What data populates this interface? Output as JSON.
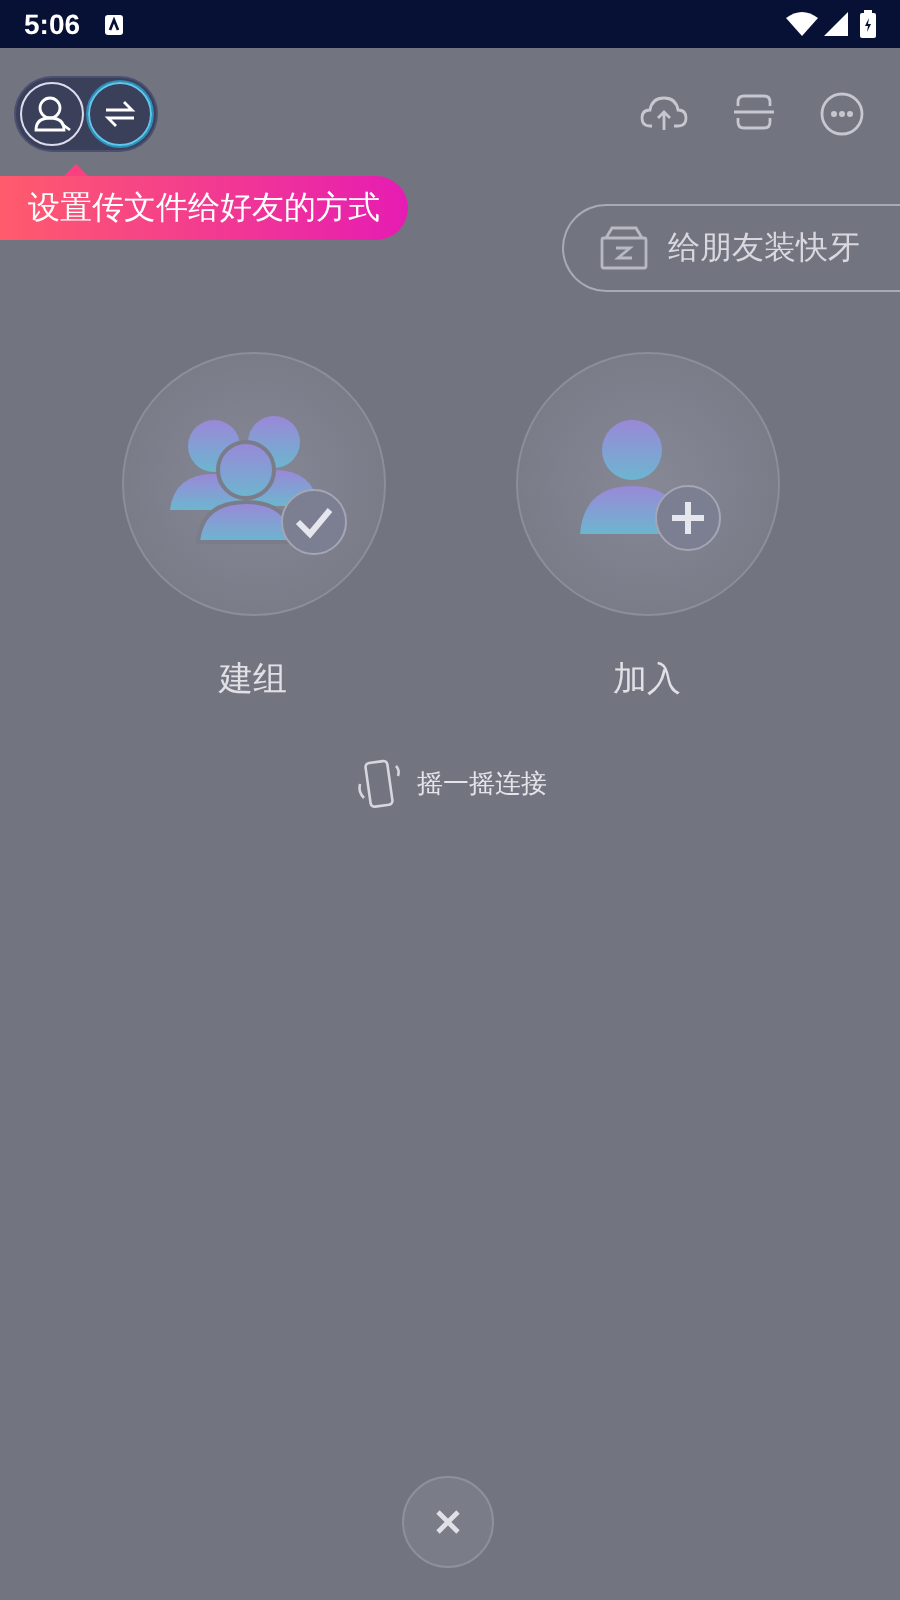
{
  "status_bar": {
    "time": "5:06"
  },
  "mode_toggle": [
    {
      "kind": "contacts",
      "selected": false
    },
    {
      "kind": "transfer",
      "selected": true
    }
  ],
  "tooltip": {
    "text": "设置传文件给好友的方式"
  },
  "install_button": {
    "label": "给朋友装快牙"
  },
  "actions": [
    {
      "kind": "create",
      "label": "建组"
    },
    {
      "kind": "join",
      "label": "加入"
    }
  ],
  "shake": {
    "label": "摇一摇连接"
  }
}
